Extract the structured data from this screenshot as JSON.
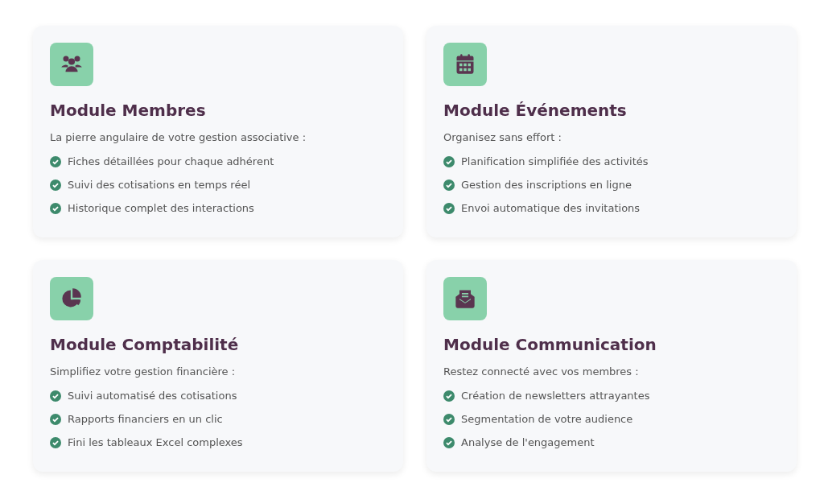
{
  "modules": [
    {
      "title": "Module Membres",
      "intro": "La pierre angulaire de votre gestion associative :",
      "features": [
        "Fiches détaillées pour chaque adhérent",
        "Suivi des cotisations en temps réel",
        "Historique complet des interactions"
      ]
    },
    {
      "title": "Module Événements",
      "intro": "Organisez sans effort :",
      "features": [
        "Planification simplifiée des activités",
        "Gestion des inscriptions en ligne",
        "Envoi automatique des invitations"
      ]
    },
    {
      "title": "Module Comptabilité",
      "intro": "Simplifiez votre gestion financière :",
      "features": [
        "Suivi automatisé des cotisations",
        "Rapports financiers en un clic",
        "Fini les tableaux Excel complexes"
      ]
    },
    {
      "title": "Module Communication",
      "intro": "Restez connecté avec vos membres :",
      "features": [
        "Création de newsletters attrayantes",
        "Segmentation de votre audience",
        "Analyse de l'engagement"
      ]
    }
  ]
}
